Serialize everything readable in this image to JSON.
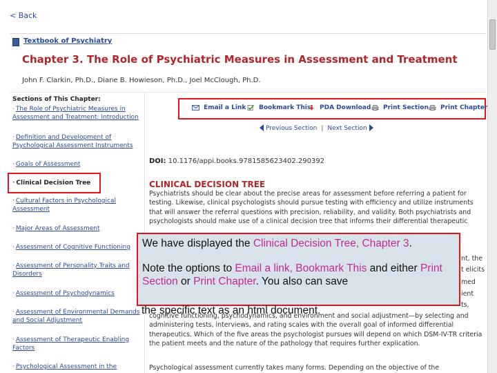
{
  "nav": {
    "back_label": "< Back"
  },
  "header": {
    "book_title": "Textbook of Psychiatry",
    "chapter_title": "Chapter 3. The Role of Psychiatric Measures in Assessment and Treatment",
    "authors": "John F. Clarkin, Ph.D., Diane B. Howieson, Ph.D., Joel McClough, Ph.D."
  },
  "sidebar": {
    "heading": "Sections of This Chapter:",
    "items": [
      {
        "label": "The Role of Psychiatric Measures in Assessment and Treatment: Introduction"
      },
      {
        "label": "Definition and Development of Psychological Assessment Instruments"
      },
      {
        "label": "Goals of Assessment"
      },
      {
        "label": "Clinical Decision Tree"
      },
      {
        "label": "Cultural Factors in Psychological Assessment"
      },
      {
        "label": "Major Areas of Assessment"
      },
      {
        "label": "Assessment of Cognitive Functioning"
      },
      {
        "label": "Assessment of Personality Traits and Disorders"
      },
      {
        "label": "Assessment of Psychodynamics"
      },
      {
        "label": "Assessment of Environmental Demands and Social Adjustment"
      },
      {
        "label": "Assessment of Therapeutic Enabling Factors"
      },
      {
        "label": "Psychological Assessment in the"
      }
    ]
  },
  "actions": {
    "email": "Email a Link",
    "bookmark": "Bookmark This",
    "pda": "PDA Download",
    "print_section": "Print Section",
    "print_chapter": "Print Chapter"
  },
  "pager": {
    "prev": "Previous Section",
    "sep": "|",
    "next": "Next Section"
  },
  "doi": {
    "label": "DOI:",
    "value": "10.1176/appi.books.9781585623402.290392"
  },
  "content": {
    "section_title": "CLINICAL DECISION TREE",
    "para1": "Psychiatrists should be clear about the precise areas for assessment before referring a patient for testing. Likewise, clinical psychologists should pursue testing with efficiency and utilize instruments that will answer the referral questions with precision, reliability, and validity. Both psychiatrists and psychologists should make use of a clinical decision tree that informs their differential therapeutic",
    "frag1": "nt, the",
    "frag2": "t elicits",
    "frag3": "med",
    "frag4": "ient",
    "frag5": "ts,",
    "para2": "cognitive functioning, psychodynamics, and environment and social adjustment—by selecting and administering tests, interviews, and rating scales with the overall goal of informed differential therapeutics. Which of the five areas the psychologist pursues will depend on which DSM-IV-TR criteria the patient meets and the nature of the pathology that requires further explication.",
    "para3": "Psychological assessment currently takes many forms. Depending on the objective of the"
  },
  "callout": {
    "p1_before": "We have displayed the ",
    "p1_pink": "Clinical Decision Tree, Chapter 3",
    "p1_after": ".",
    "p2_a": "Note the options to ",
    "p2_b": "Email a link, Bookmark This",
    "p2_c": " and either ",
    "p2_d": "Print Section",
    "p2_e": " or ",
    "p2_f": "Print Chapter",
    "p2_g": ".  You also can save",
    "overflow": "the specific text as an html document."
  },
  "colors": {
    "accent_red": "#b0262a",
    "link_blue": "#2a4a9a",
    "highlight_red": "#e8121c",
    "callout_bg": "#d7e2eb",
    "callout_pink": "#c42a8e"
  }
}
